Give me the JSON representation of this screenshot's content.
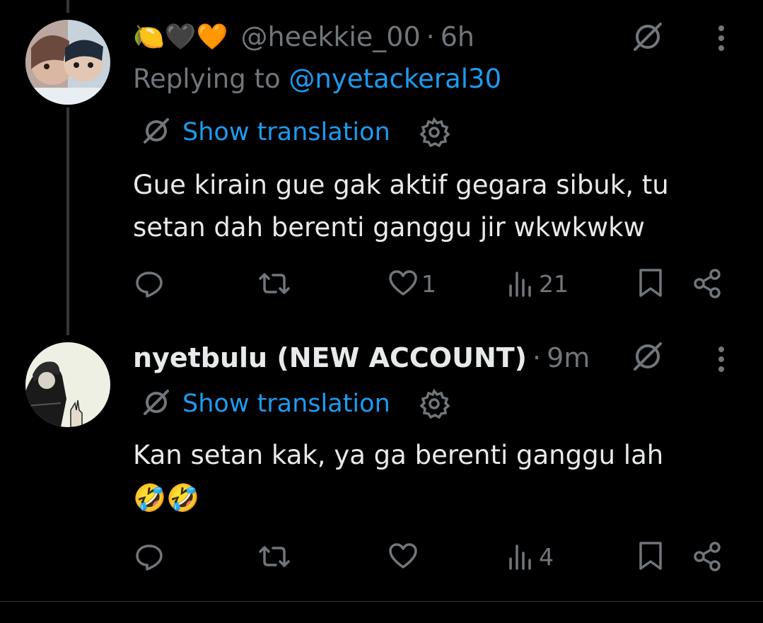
{
  "posts": [
    {
      "display_emojis": "🍋🖤🧡",
      "handle": "@heekkie_00",
      "separator": "·",
      "time": "6h",
      "replying_prefix": "Replying to",
      "replying_to": "@nyetackeral30",
      "translate_label": "Show translation",
      "text_lines": [
        "Gue kirain gue gak aktif gegara sibuk, tu",
        "setan dah berenti ganggu jir wkwkwkw"
      ],
      "likes": "1",
      "views": "21"
    },
    {
      "name": "nyetbulu (NEW ACCOUNT)",
      "separator": "·",
      "time": "9m",
      "translate_label": "Show translation",
      "text_lines": [
        "Kan setan kak, ya ga berenti ganggu lah",
        "🤣🤣"
      ],
      "likes": "",
      "views": "4"
    }
  ],
  "colors": {
    "background": "#000000",
    "text": "#e7e9ea",
    "secondary": "#71767b",
    "link": "#1d9bf0"
  },
  "icons": [
    "translate-icon",
    "more-icon",
    "globe-translate-icon",
    "settings-gear-icon",
    "reply-icon",
    "repost-icon",
    "like-icon",
    "views-icon",
    "bookmark-icon",
    "share-icon"
  ]
}
